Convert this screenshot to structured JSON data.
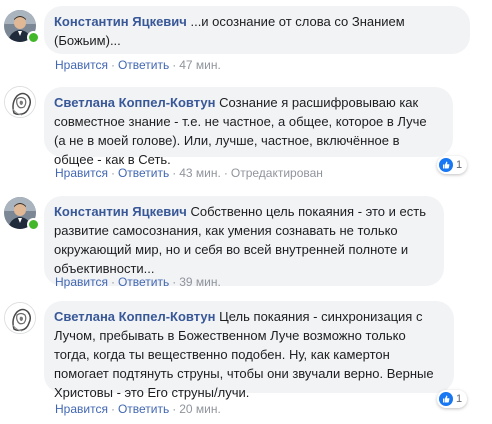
{
  "comments": [
    {
      "author": "Константин Яцкевич",
      "text": "...и осознание от слова со Знанием (Божьим)...",
      "like_label": "Нравится",
      "reply_label": "Ответить",
      "time": "47 мин.",
      "online": true
    },
    {
      "author": "Светлана Коппел-Ковтун",
      "text": "Сознание я расшифровываю как совместное знание - т.е. не частное, а общее, которое в Луче (а не в моей голове). Или, лучше, частное, включённое в общее - как в Сеть.",
      "like_label": "Нравится",
      "reply_label": "Ответить",
      "time": "43 мин.",
      "edited": "Отредактирован",
      "reaction_count": "1"
    },
    {
      "author": "Константин Яцкевич",
      "text": "Собственно цель покаяния - это и есть развитие самосознания, как умения сознавать не только окружающий мир, но и себя во всей внутренней полноте и объективности...",
      "like_label": "Нравится",
      "reply_label": "Ответить",
      "time": "39 мин.",
      "online": true
    },
    {
      "author": "Светлана Коппел-Ковтун",
      "text": "Цель покаяния - синхронизация с Лучом, пребывать в Божественном Луче возможно только тогда, когда ты вещественно подобен. Ну, как камертон помогает подтянуть струны, чтобы они звучали верно. Верные Христовы - это Его струны/лучи.",
      "like_label": "Нравится",
      "reply_label": "Ответить",
      "time": "20 мин.",
      "reaction_count": "1"
    }
  ],
  "colors": {
    "author": "#385898",
    "link": "#4267b2",
    "meta": "#90949c",
    "bubble": "#f2f3f5",
    "online": "#42b72a",
    "like": "#1877f2"
  }
}
